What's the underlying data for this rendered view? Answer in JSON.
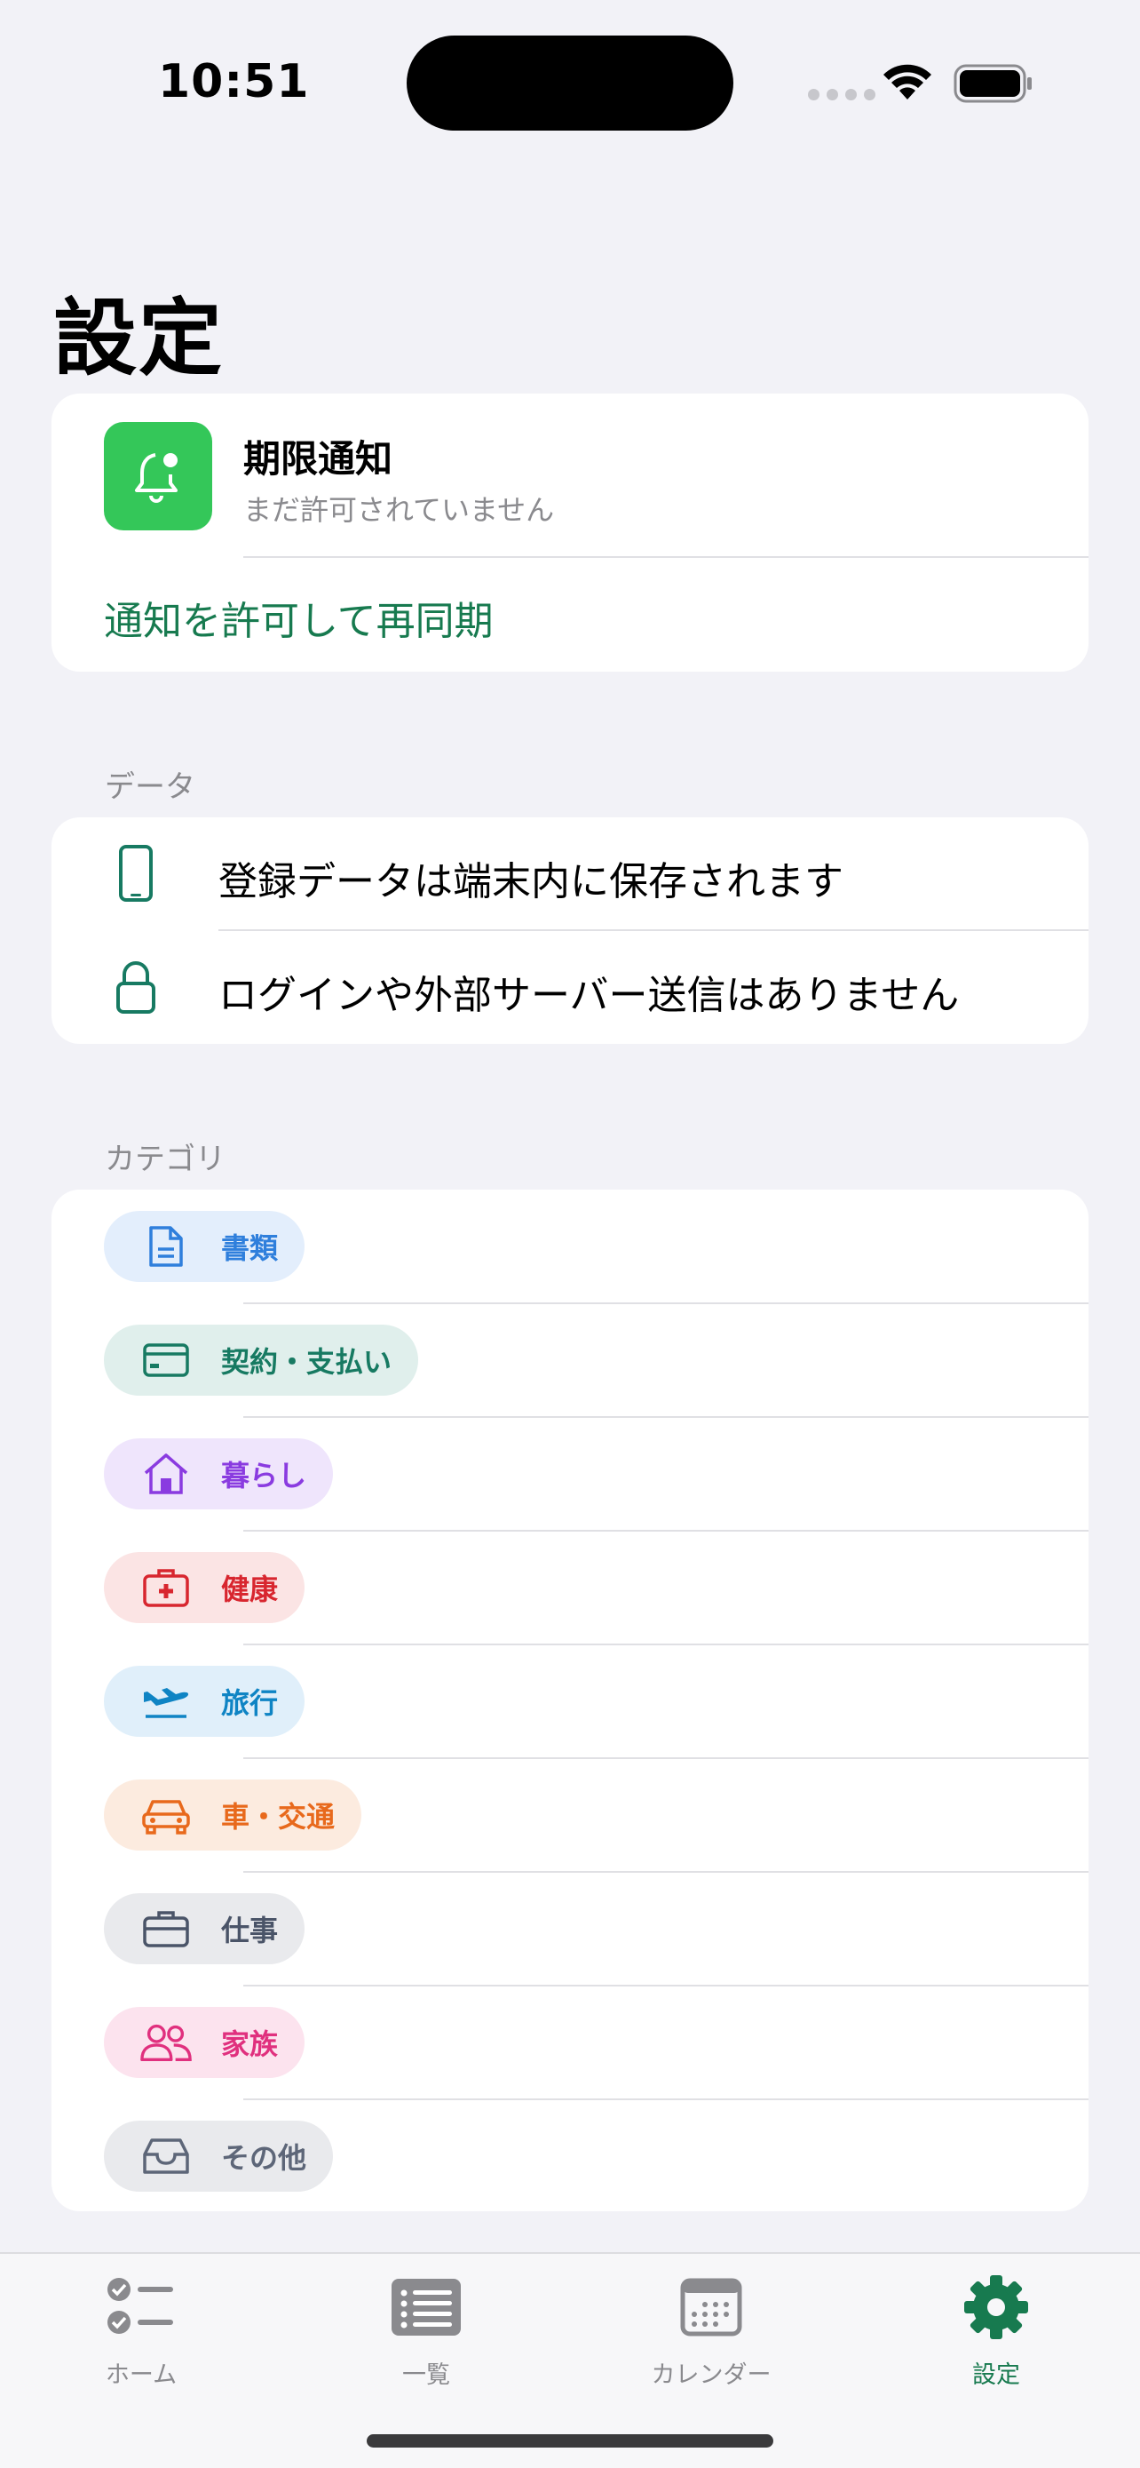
{
  "status_bar": {
    "time": "10:51"
  },
  "page": {
    "title": "設定"
  },
  "notification": {
    "title": "期限通知",
    "subtitle": "まだ許可されていません",
    "action": "通知を許可して再同期",
    "icon": "bell-badge-icon"
  },
  "data_section": {
    "header": "データ",
    "rows": [
      {
        "icon": "phone-icon",
        "text": "登録データは端末内に保存されます"
      },
      {
        "icon": "lock-icon",
        "text": "ログインや外部サーバー送信はありません"
      }
    ]
  },
  "category_section": {
    "header": "カテゴリ",
    "items": [
      {
        "label": "書類",
        "icon": "document-icon",
        "color": "#2f7fdc",
        "bg": "#e3eefc"
      },
      {
        "label": "契約・支払い",
        "icon": "credit-card-icon",
        "color": "#177a62",
        "bg": "#e0efec"
      },
      {
        "label": "暮らし",
        "icon": "house-icon",
        "color": "#8a3be0",
        "bg": "#efe5fc"
      },
      {
        "label": "健康",
        "icon": "medical-kit-icon",
        "color": "#d8262f",
        "bg": "#fbe4e4"
      },
      {
        "label": "旅行",
        "icon": "airplane-icon",
        "color": "#0f84c4",
        "bg": "#e0effa"
      },
      {
        "label": "車・交通",
        "icon": "car-icon",
        "color": "#e8691c",
        "bg": "#fcebdf"
      },
      {
        "label": "仕事",
        "icon": "briefcase-icon",
        "color": "#4a5468",
        "bg": "#e9eaed"
      },
      {
        "label": "家族",
        "icon": "people-icon",
        "color": "#e0307e",
        "bg": "#fce3ee"
      },
      {
        "label": "その他",
        "icon": "tray-icon",
        "color": "#5d6678",
        "bg": "#e9eaed"
      }
    ]
  },
  "tabbar": {
    "tabs": [
      {
        "label": "ホーム",
        "icon": "checklist-icon",
        "active": false
      },
      {
        "label": "一覧",
        "icon": "list-icon",
        "active": false
      },
      {
        "label": "カレンダー",
        "icon": "calendar-icon",
        "active": false
      },
      {
        "label": "設定",
        "icon": "gear-icon",
        "active": true
      }
    ]
  },
  "colors": {
    "accent": "#177a4f",
    "bell_bg": "#34c759"
  }
}
